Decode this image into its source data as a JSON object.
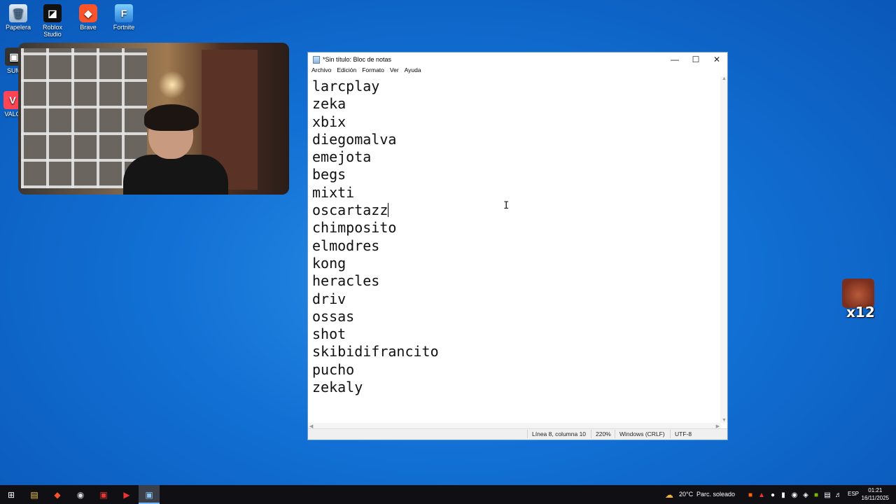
{
  "desktop": {
    "icons": [
      {
        "label": "Papelera",
        "icon": "recycle-bin-icon"
      },
      {
        "label": "Roblox Studio",
        "icon": "roblox-studio-icon"
      },
      {
        "label": "Brave",
        "icon": "brave-icon"
      },
      {
        "label": "Fortnite",
        "icon": "fortnite-icon"
      },
      {
        "label": "SUM",
        "icon": "app-icon"
      },
      {
        "label": "VALO",
        "icon": "valorant-icon"
      }
    ]
  },
  "notepad": {
    "title": "*Sin título: Bloc de notas",
    "menu": [
      "Archivo",
      "Edición",
      "Formato",
      "Ver",
      "Ayuda"
    ],
    "lines": [
      "larcplay",
      "zeka",
      "xbix",
      "diegomalva",
      "emejota",
      "begs",
      "mixti",
      "oscartazz",
      "chimposito",
      "elmodres",
      "kong",
      "heracles",
      "driv",
      "ossas",
      "shot",
      "skibidifrancito",
      "pucho",
      "zekaly"
    ],
    "status": {
      "position": "Línea 8, columna 10",
      "zoom": "220%",
      "line_ending": "Windows (CRLF)",
      "encoding": "UTF-8"
    }
  },
  "sticker": {
    "count": "x12"
  },
  "taskbar": {
    "weather_temp": "20°C",
    "weather_text": "Parc. soleado",
    "language": "ESP",
    "time": "01:21",
    "date": "16/11/2025"
  },
  "colors": {
    "taskbar": "#0f0f14",
    "desktop": "#1270d4",
    "accent": "#77b7ff"
  }
}
